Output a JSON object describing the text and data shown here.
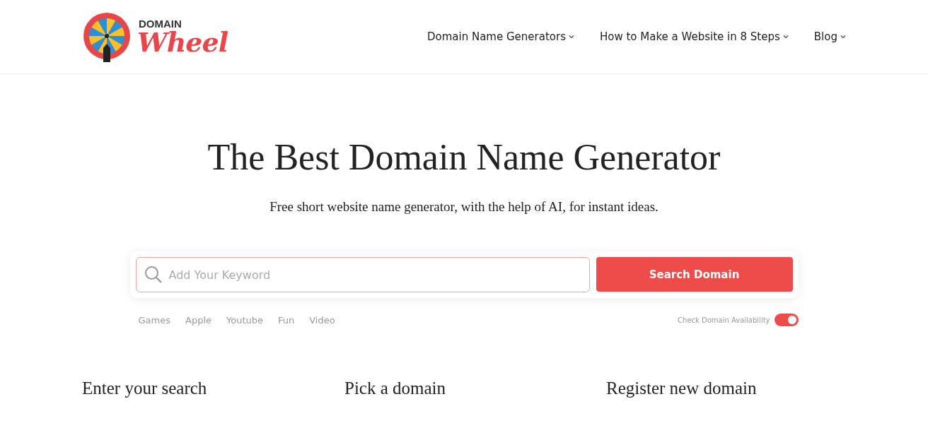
{
  "header": {
    "logo": {
      "top": "DOMAIN",
      "bottom": "Wheel"
    },
    "nav": [
      {
        "label": "Domain Name Generators"
      },
      {
        "label": "How to Make a Website in 8 Steps"
      },
      {
        "label": "Blog"
      }
    ]
  },
  "hero": {
    "title": "The Best Domain Name Generator",
    "subtitle": "Free short website name generator, with the help of AI, for instant ideas."
  },
  "search": {
    "placeholder": "Add Your Keyword",
    "button": "Search Domain",
    "suggestions": [
      "Games",
      "Apple",
      "Youtube",
      "Fun",
      "Video"
    ],
    "availability": {
      "label": "Check Domain Availability",
      "on": true
    }
  },
  "steps": [
    {
      "title": "Enter your search"
    },
    {
      "title": "Pick a domain"
    },
    {
      "title": "Register new domain"
    }
  ]
}
